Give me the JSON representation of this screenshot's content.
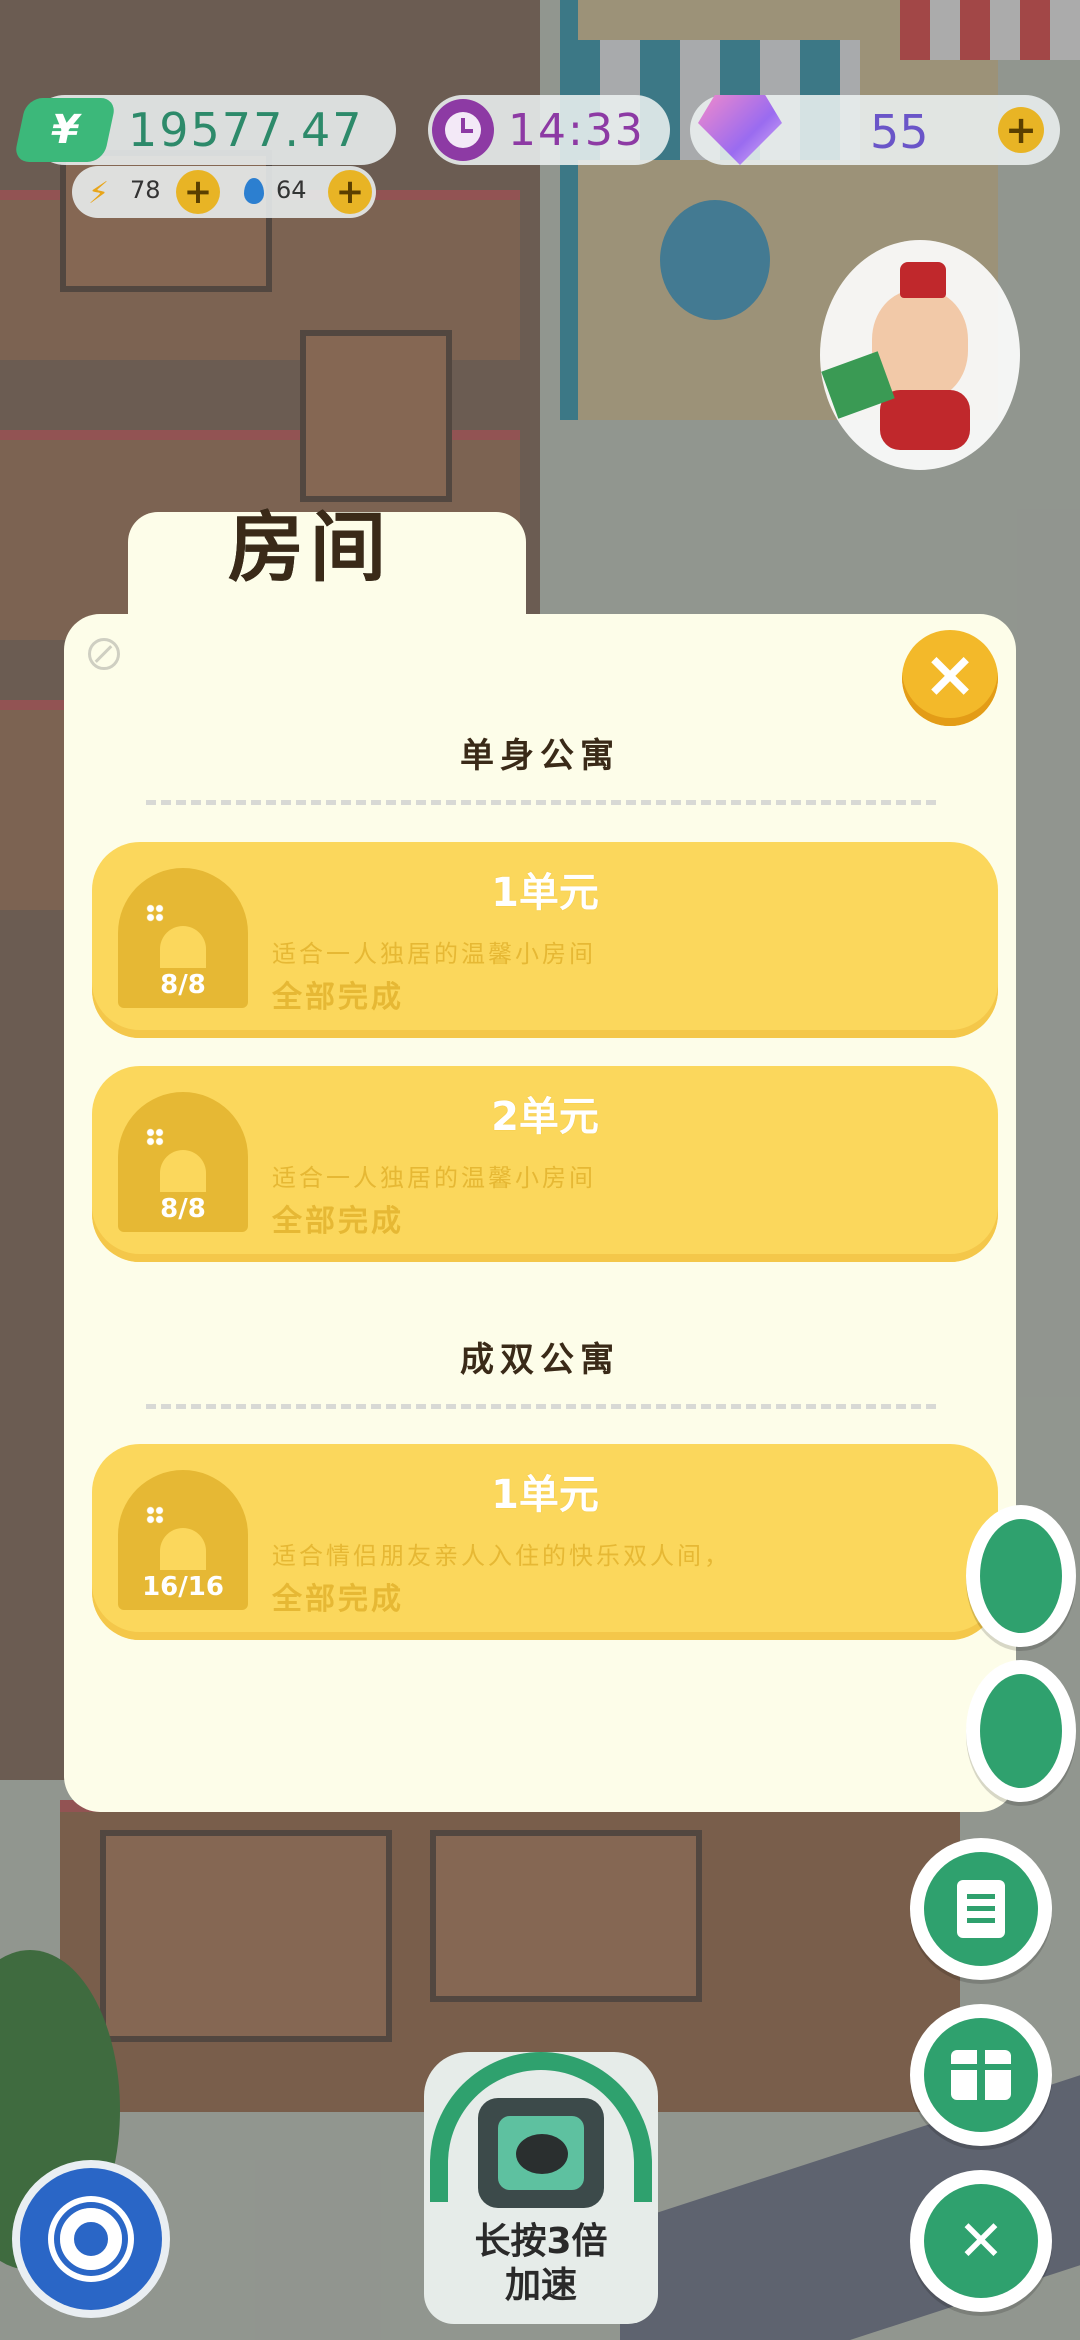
{
  "hud": {
    "money": "19577.47",
    "money_symbol": "¥",
    "clock": "14:33",
    "gems": "55",
    "energy": "78",
    "water": "64",
    "plus": "+"
  },
  "modal": {
    "title": "房间",
    "close": "×",
    "sections": [
      {
        "title": "单身公寓",
        "cards": [
          {
            "name": "1单元",
            "count": "8/8",
            "desc": "适合一人独居的温馨小房间",
            "status": "全部完成"
          },
          {
            "name": "2单元",
            "count": "8/8",
            "desc": "适合一人独居的温馨小房间",
            "status": "全部完成"
          }
        ]
      },
      {
        "title": "成双公寓",
        "cards": [
          {
            "name": "1单元",
            "count": "16/16",
            "desc": "适合情侣朋友亲人入住的快乐双人间，",
            "status": "全部完成"
          }
        ]
      }
    ]
  },
  "speed_button": {
    "line1": "长按3倍",
    "line2": "加速"
  },
  "colors": {
    "card": "#fbd75c",
    "accent_green": "#2fa16e",
    "close": "#f3b92a",
    "settings": "#2a66c6"
  },
  "icons": [
    "money-icon",
    "clock-icon",
    "gem-icon",
    "energy-icon",
    "water-icon",
    "close-icon",
    "house-icon",
    "document-icon",
    "gift-icon",
    "tools-icon",
    "settings-gear-icon",
    "tv-fast-forward-icon"
  ]
}
